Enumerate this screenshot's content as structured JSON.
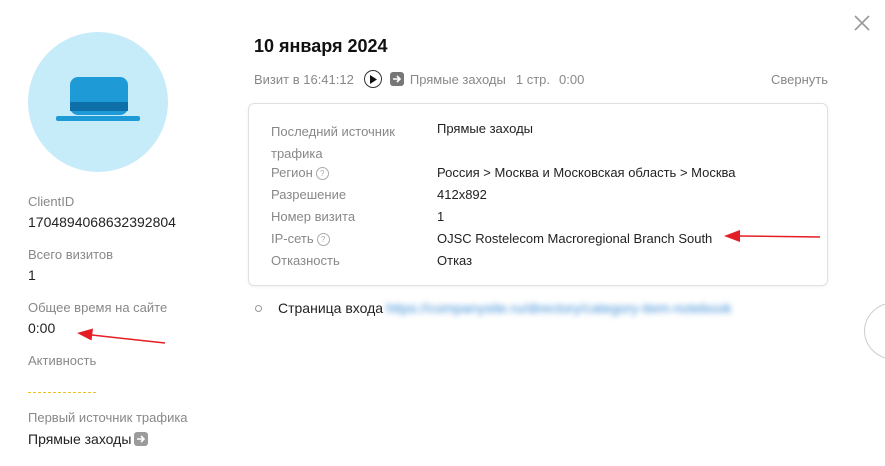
{
  "header": {
    "date": "10 января 2024",
    "visit_label": "Визит в 16:41:12",
    "traffic": "Прямые заходы",
    "pages": "1 стр.",
    "duration": "0:00",
    "collapse": "Свернуть"
  },
  "sidebar": {
    "client_id_label": "ClientID",
    "client_id": "1704894068632392804",
    "visits_label": "Всего визитов",
    "visits": "1",
    "time_label": "Общее время на сайте",
    "time": "0:00",
    "activity_label": "Активность",
    "first_source_label": "Первый источник трафика",
    "first_source": "Прямые заходы"
  },
  "details": {
    "rows": [
      {
        "label": "Последний источник трафика",
        "value": "Прямые заходы"
      },
      {
        "label": "Регион",
        "value": "Россия > Москва и Московская область > Москва"
      },
      {
        "label": "Разрешение",
        "value": "412x892"
      },
      {
        "label": "Номер визита",
        "value": "1"
      },
      {
        "label": "IP-сеть",
        "value": "OJSC Rostelecom Macroregional Branch South"
      },
      {
        "label": "Отказность",
        "value": "Отказ"
      }
    ],
    "help_glyph": "?"
  },
  "entry_page": {
    "label": "Страница входа",
    "url": "https://companysite.ru/directory/category-item-notebook"
  },
  "colors": {
    "avatar_bg": "#c6ebf9",
    "hat": "#1e9bd7",
    "annotation_arrow": "#e31e24",
    "activity_dash": "#f1c21b"
  },
  "icons": [
    "hat-icon",
    "play-icon",
    "arrow-right-icon",
    "close-icon",
    "help-icon"
  ]
}
